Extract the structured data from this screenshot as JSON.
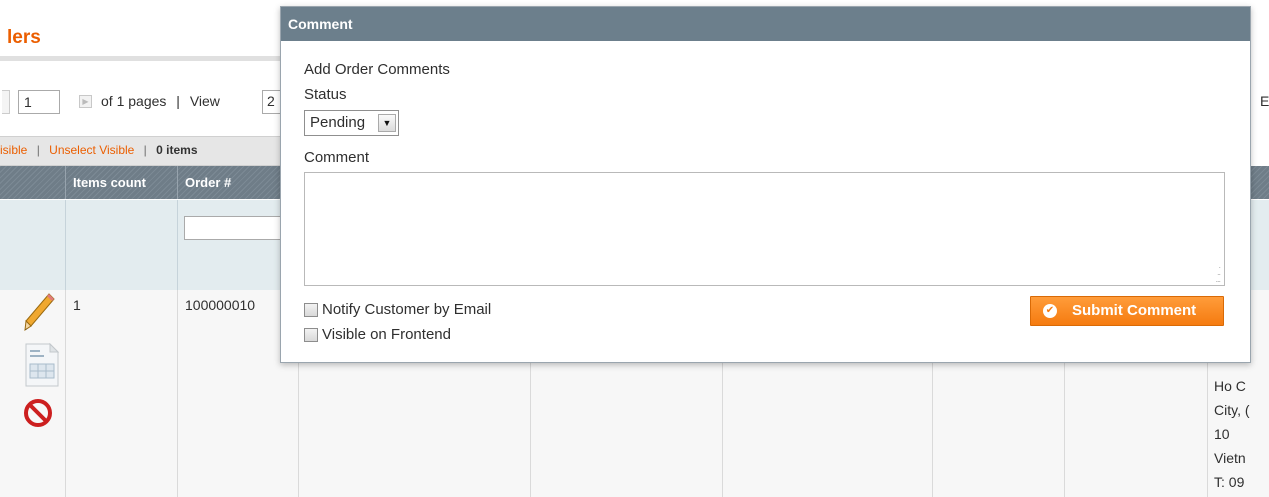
{
  "page": {
    "title_fragment": "lers"
  },
  "pager": {
    "page_value": "1",
    "of_pages": "of 1 pages",
    "separator": "|",
    "view_label": "View",
    "view_value": "2",
    "right_fragment": "E"
  },
  "massaction": {
    "select_visible": "isible",
    "unselect_visible": "Unselect Visible",
    "separator": "|",
    "items_selected": "0 items"
  },
  "grid": {
    "columns": [
      "Items count",
      "Order #"
    ],
    "row": {
      "items_count": "1",
      "order_number": "100000010"
    },
    "address_lines": [
      "Ho C",
      "City, (",
      "10",
      "Vietn",
      "T: 09"
    ]
  },
  "modal": {
    "title": "Comment",
    "heading": "Add Order Comments",
    "status_label": "Status",
    "status_value": "Pending",
    "comment_label": "Comment",
    "comment_value": "",
    "notify_label": "Notify Customer by Email",
    "visible_label": "Visible on Frontend",
    "notify_checked": false,
    "visible_checked": false,
    "submit_label": "Submit Comment"
  },
  "icons": {
    "edit": "pencil-icon",
    "view": "document-icon",
    "cancel": "no-entry-icon",
    "submit": "checkmark-icon"
  },
  "colors": {
    "accent_orange": "#eb5e00",
    "button_orange": "#f57b10",
    "modal_header": "#6c7f8c",
    "grid_header": "#73818c"
  }
}
